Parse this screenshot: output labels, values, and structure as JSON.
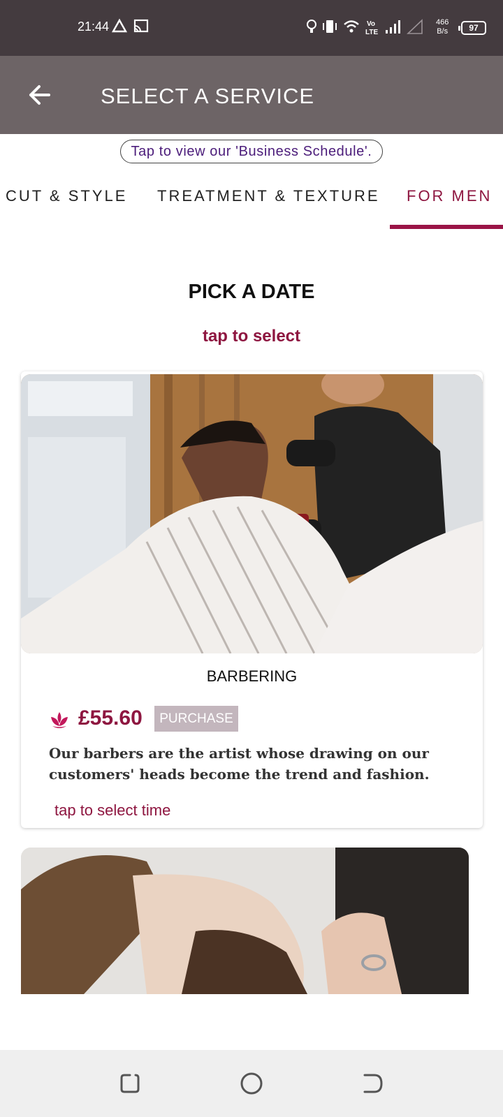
{
  "status_bar": {
    "time": "21:44",
    "net_speed_value": "466",
    "net_speed_unit": "B/s",
    "battery": "97",
    "icons": [
      "drive-icon",
      "cast-icon",
      "bulb-icon",
      "vibrate-icon",
      "wifi-icon",
      "volte-icon",
      "signal-icon",
      "signal-empty-icon"
    ]
  },
  "app_bar": {
    "title": "SELECT A SERVICE",
    "back_icon": "arrow-left-icon"
  },
  "schedule_link": "Tap to view our 'Business Schedule'.",
  "tabs": [
    {
      "label": "CUT & STYLE",
      "active": false
    },
    {
      "label": "TREATMENT & TEXTURE",
      "active": false
    },
    {
      "label": "FOR MEN",
      "active": true
    }
  ],
  "pick_date": {
    "heading": "PICK A DATE",
    "action": "tap to select"
  },
  "services": [
    {
      "name": "BARBERING",
      "price": "£55.60",
      "purchase_label": "PURCHASE",
      "description": "Our barbers are the artist whose drawing on our customers' heads become the trend and fashion.",
      "time_action": "tap to select time",
      "icon": "lotus-icon"
    }
  ],
  "colors": {
    "accent": "#8e1640",
    "status_bar": "#443b3f",
    "app_bar": "#6d6466",
    "purchase_bg": "#c3b6bd"
  },
  "nav_bar": {
    "icons": [
      "recents-icon",
      "home-icon",
      "back-icon"
    ]
  }
}
